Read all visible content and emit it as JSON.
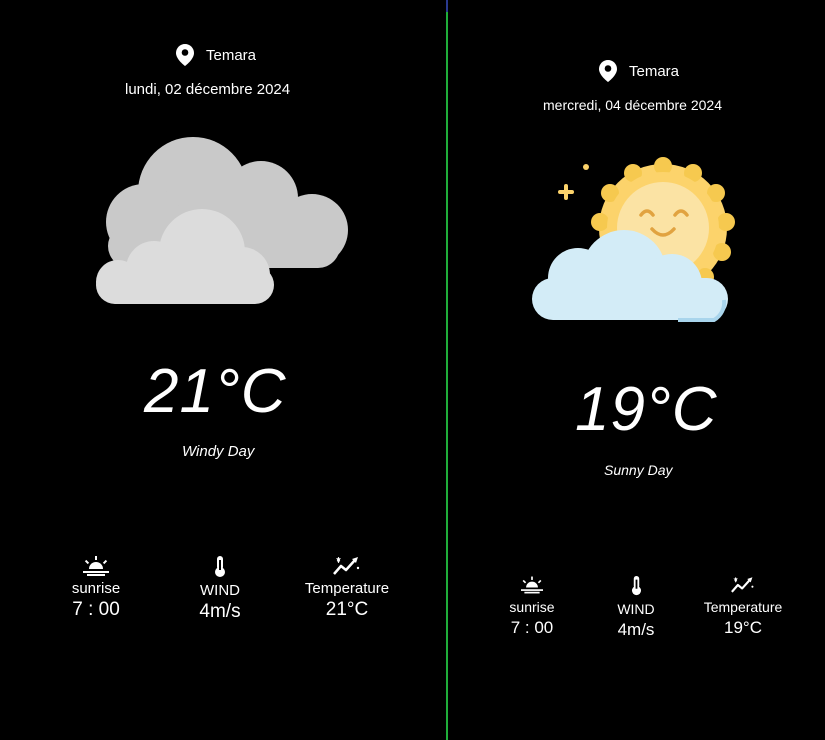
{
  "left": {
    "location": "Temara",
    "date": "lundi, 02 décembre 2024",
    "temperature": "21°C",
    "description": "Windy Day",
    "weather_icon": "cloudy-icon",
    "stats": [
      {
        "icon": "sunrise-icon",
        "label": "sunrise",
        "value": "7 : 00"
      },
      {
        "icon": "thermometer-icon",
        "label": "WIND",
        "value": "4m/s"
      },
      {
        "icon": "temperature-trend-icon",
        "label": "Temperature",
        "value": "21°C"
      }
    ]
  },
  "right": {
    "location": "Temara",
    "date": "mercredi, 04 décembre 2024",
    "temperature": "19°C",
    "description": "Sunny Day",
    "weather_icon": "sun-behind-cloud-icon",
    "stats": [
      {
        "icon": "sunrise-icon",
        "label": "sunrise",
        "value": "7 : 00"
      },
      {
        "icon": "thermometer-icon",
        "label": "WIND",
        "value": "4m/s"
      },
      {
        "icon": "temperature-trend-icon",
        "label": "Temperature",
        "value": "19°C"
      }
    ]
  },
  "colors": {
    "background": "#000000",
    "text": "#ffffff",
    "cloud_dark": "#c9c9c9",
    "cloud_light": "#dcdcdc",
    "sun": "#fcd36b",
    "sun_face": "#fbe3a4",
    "cloud_blue": "#d3ecf7",
    "divider": "#1fae3a"
  }
}
